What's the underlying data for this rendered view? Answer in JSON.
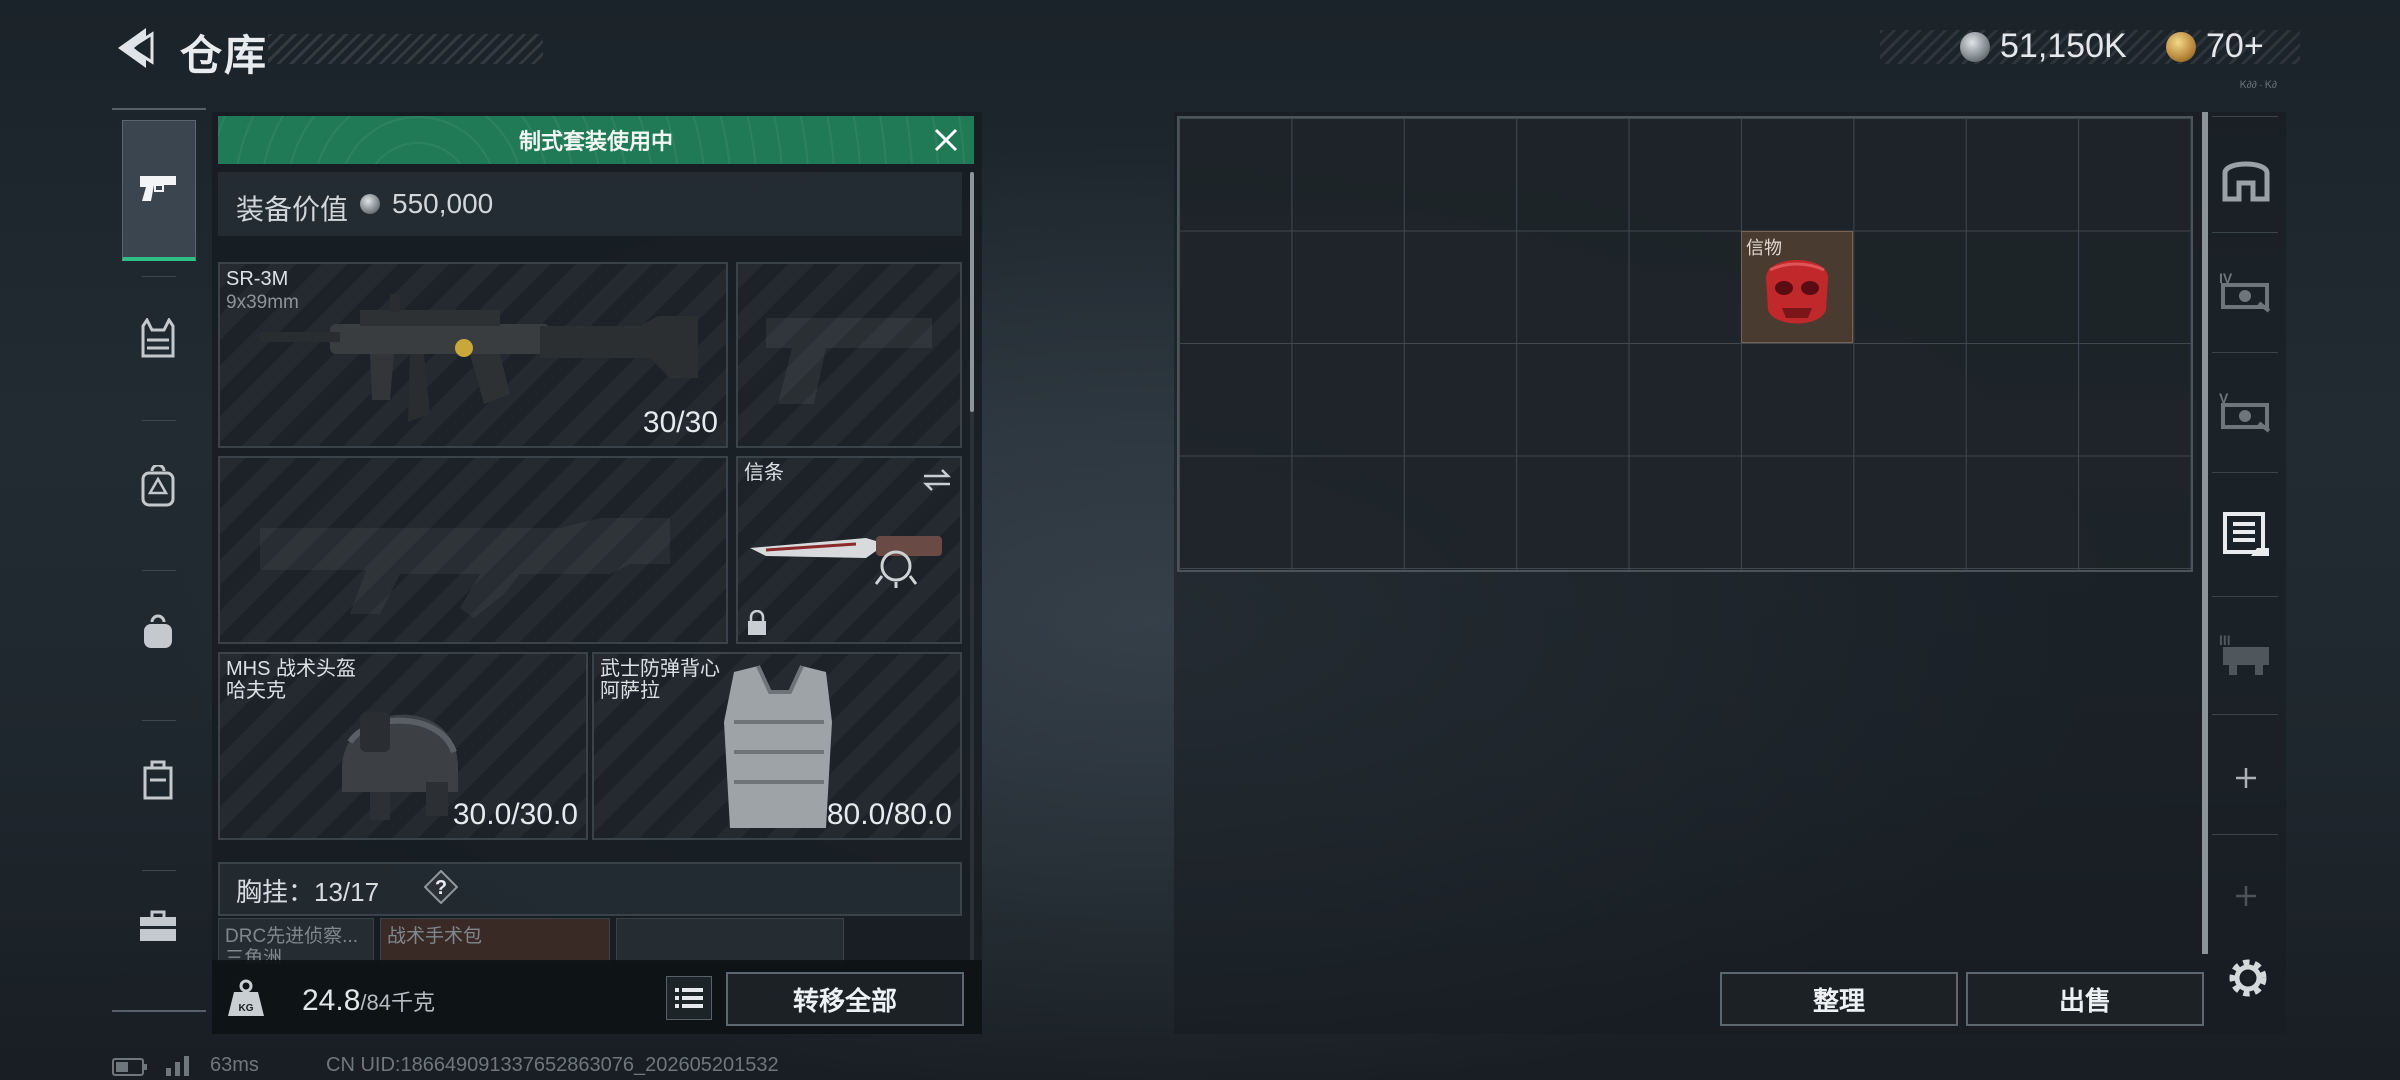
{
  "header": {
    "title": "仓库",
    "currency_1": "51,150K",
    "currency_2": "70+"
  },
  "nav": {
    "items": [
      "pistol-icon",
      "vest-icon",
      "backpack-icon",
      "bag-icon",
      "case-icon",
      "toolbox-icon"
    ],
    "active_index": 0
  },
  "loadout": {
    "banner": "制式套装使用中",
    "value_label": "装备价值",
    "value": "550,000",
    "primary": {
      "name": "SR-3M",
      "ammo_type": "9x39mm",
      "ammo": "30/30"
    },
    "sidearm_empty": true,
    "secondary_empty": true,
    "melee": {
      "label": "信条"
    },
    "helmet": {
      "name_line1": "MHS 战术头盔",
      "name_line2": "哈夫克",
      "durability": "30.0/30.0"
    },
    "armor": {
      "name_line1": "武士防弹背心",
      "name_line2": "阿萨拉",
      "durability": "80.0/80.0"
    },
    "chest_label": "胸挂：",
    "chest_value": "13/17",
    "chest_help": "?",
    "chest_items": [
      "DRC先进侦察...",
      "战术手术包"
    ],
    "chest_item_sub": "三角洲",
    "weight_value": "24.8",
    "weight_capacity": "/84千克",
    "transfer_all": "转移全部"
  },
  "storage": {
    "item_label": "信物",
    "sort_button": "整理",
    "sell_button": "出售",
    "rail_icons": [
      "safe-box-icon",
      "storage-tier-4-icon",
      "storage-tier-5-icon",
      "document-icon",
      "storage-tier-3-icon",
      "add-icon",
      "add-disabled-icon"
    ],
    "rail_top_label": "Ꮶ∂∂ ∙ Ꮶ∂"
  },
  "status": {
    "ping": "63ms",
    "uid": "CN UID:18664909133765286307­6_202605201532"
  },
  "colors": {
    "banner_green": "#1f7a55",
    "active_nav_underline": "#2fbf86",
    "mask_red": "#c0282c"
  }
}
